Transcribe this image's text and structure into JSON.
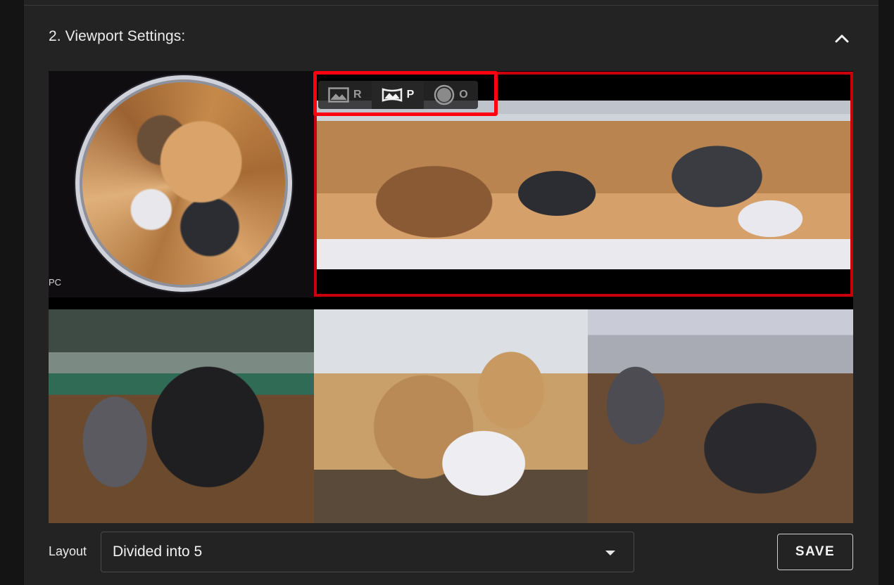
{
  "section": {
    "title": "2. Viewport Settings:",
    "collapse_icon": "chevron-up-icon"
  },
  "viewport": {
    "fisheye_corner_label": "PC",
    "modes": [
      {
        "label": "R",
        "icon": "image-icon",
        "active": false
      },
      {
        "label": "P",
        "icon": "panorama-icon",
        "active": true
      },
      {
        "label": "O",
        "icon": "circle-icon",
        "active": false
      }
    ],
    "highlight_color": "#ff0010",
    "selected_frame_color": "#c8000b"
  },
  "layout": {
    "label": "Layout",
    "selected": "Divided into 5"
  },
  "actions": {
    "save_label": "SAVE"
  }
}
